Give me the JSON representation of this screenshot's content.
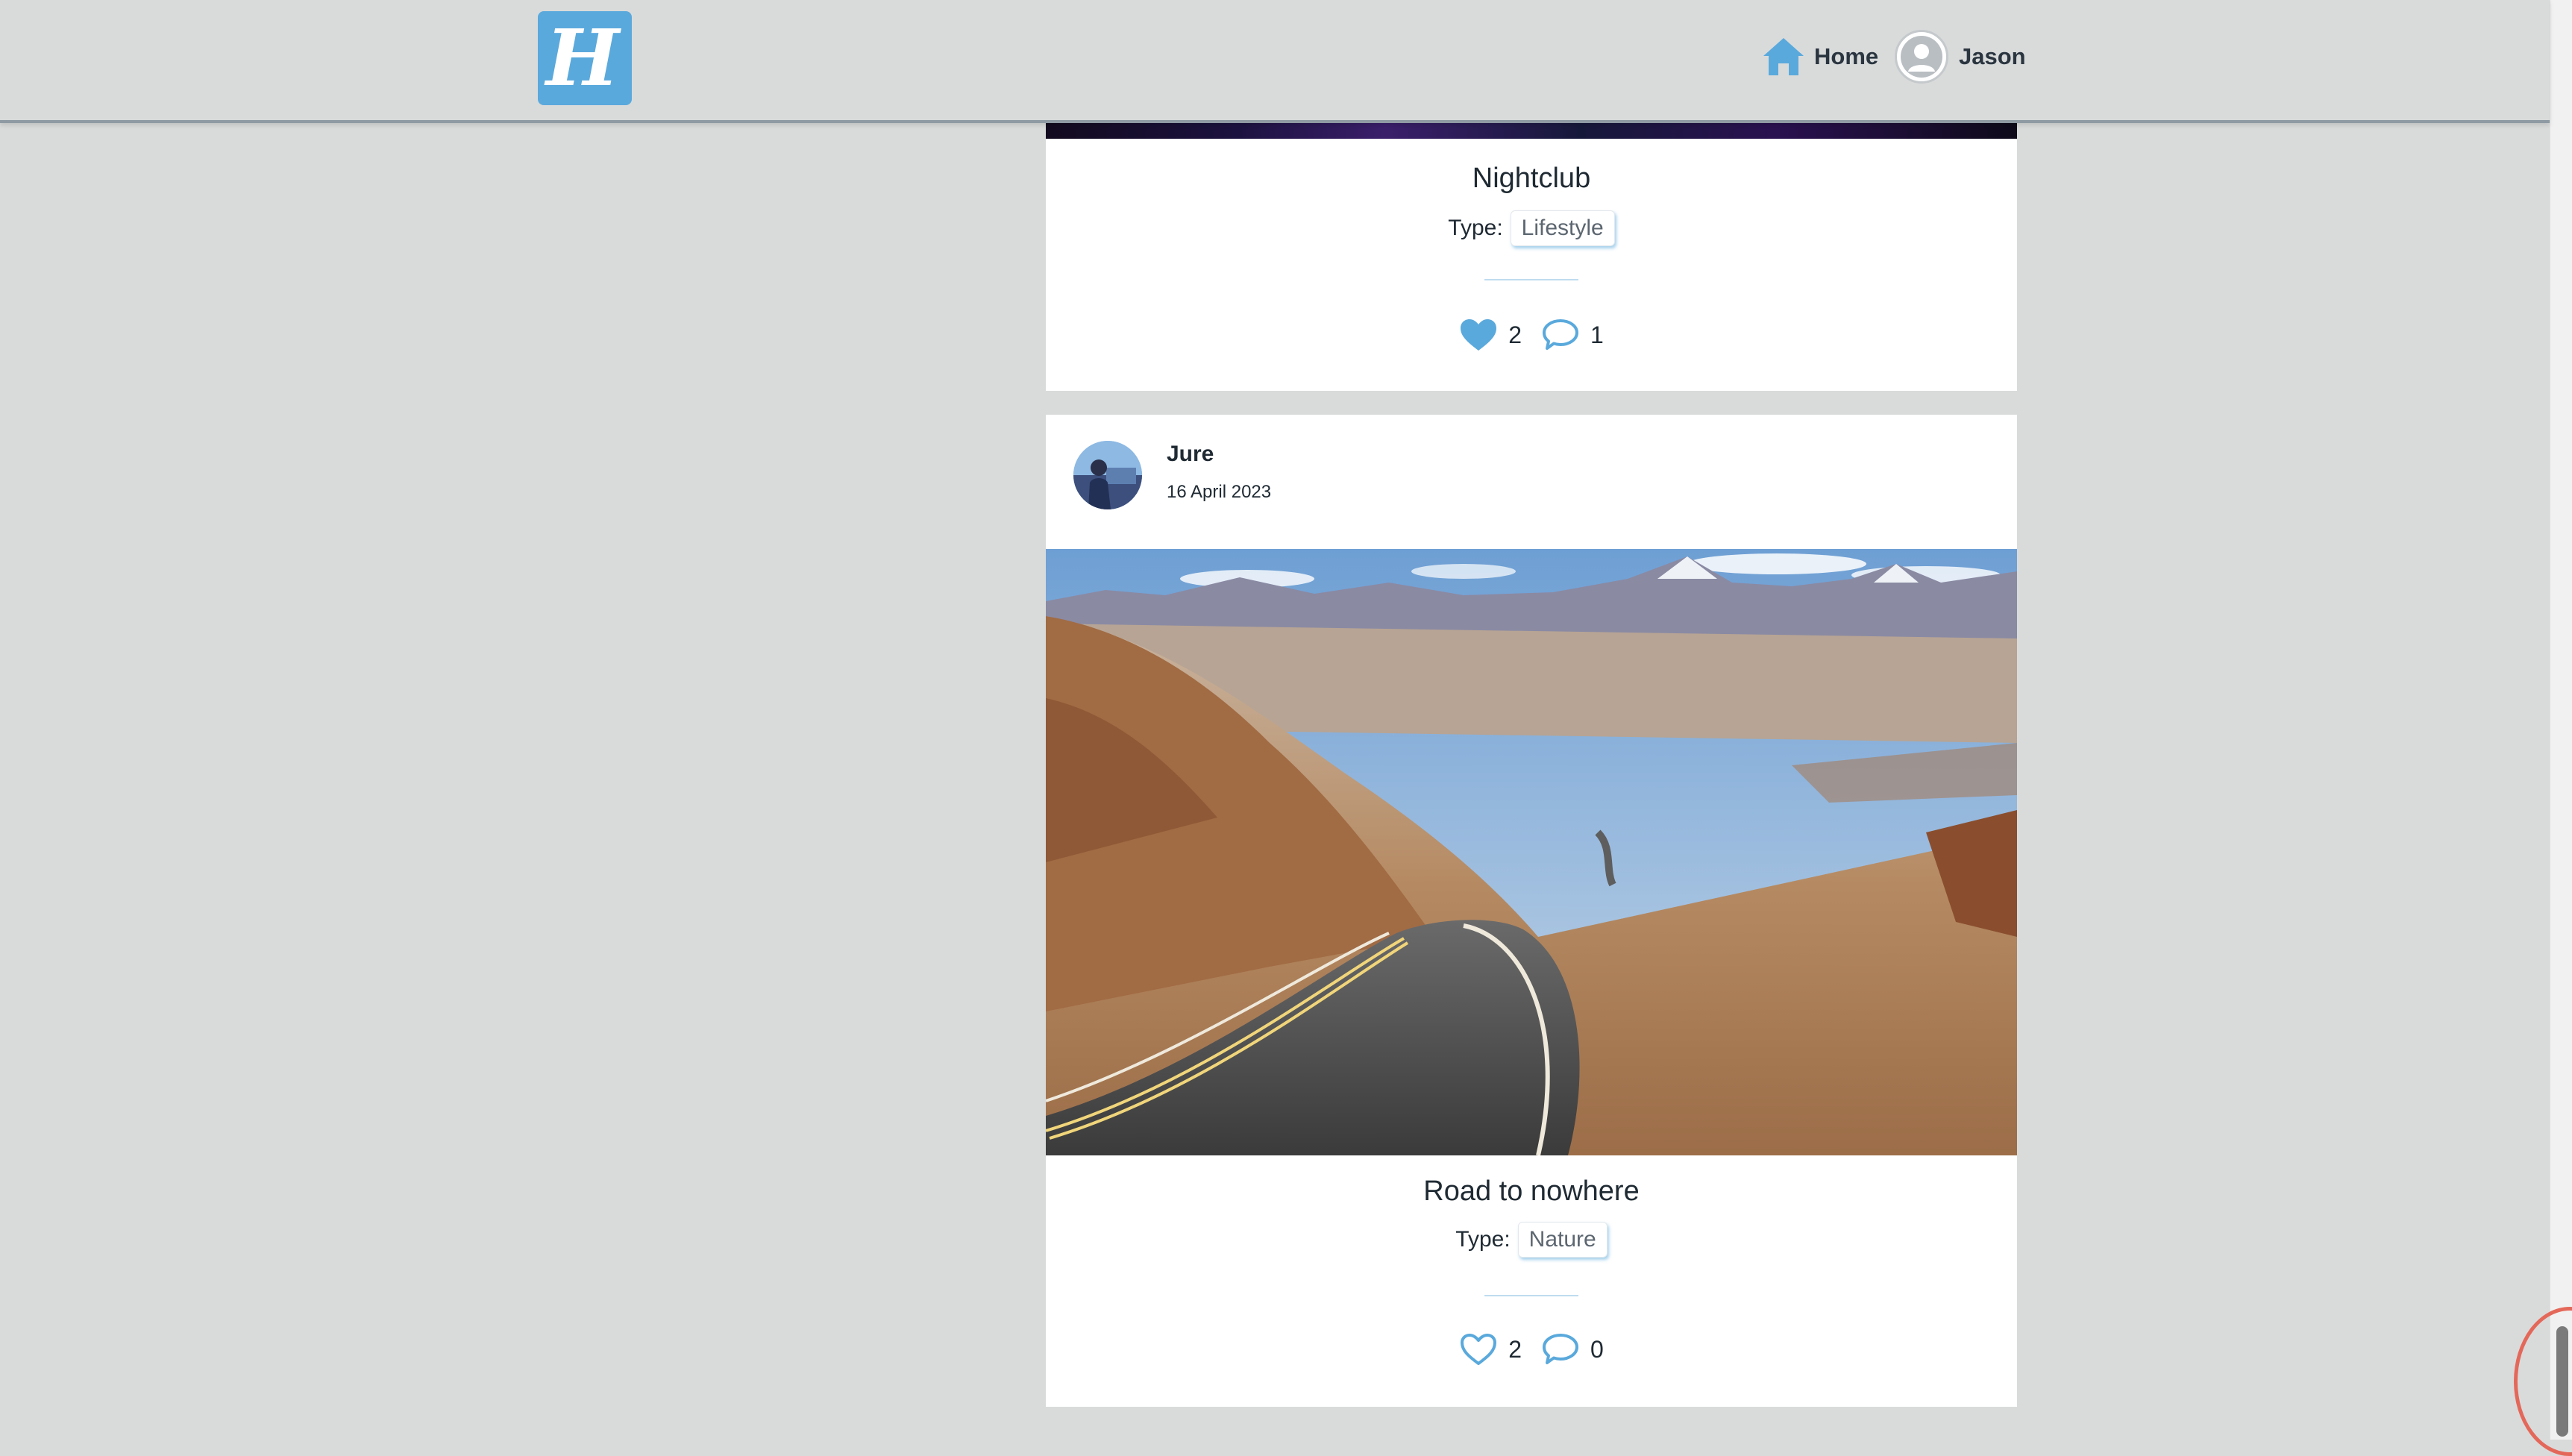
{
  "header": {
    "logo_letter": "H",
    "nav_home_label": "Home",
    "user_name": "Jason"
  },
  "posts": [
    {
      "title": "Nightclub",
      "type_label": "Type:",
      "type_value": "Lifestyle",
      "likes": "2",
      "comments": "1",
      "liked": true
    },
    {
      "author": "Jure",
      "date": "16 April 2023",
      "title": "Road to nowhere",
      "type_label": "Type:",
      "type_value": "Nature",
      "likes": "2",
      "comments": "0",
      "liked": false
    }
  ],
  "colors": {
    "accent": "#5aa9dc",
    "background": "#d9dbdb",
    "card": "#ffffff",
    "highlight_ring": "#e4685a"
  },
  "icons": {
    "home": "home-icon",
    "user": "user-avatar-icon",
    "like_filled": "heart-filled-icon",
    "like_outline": "heart-outline-icon",
    "comment": "comment-icon"
  }
}
